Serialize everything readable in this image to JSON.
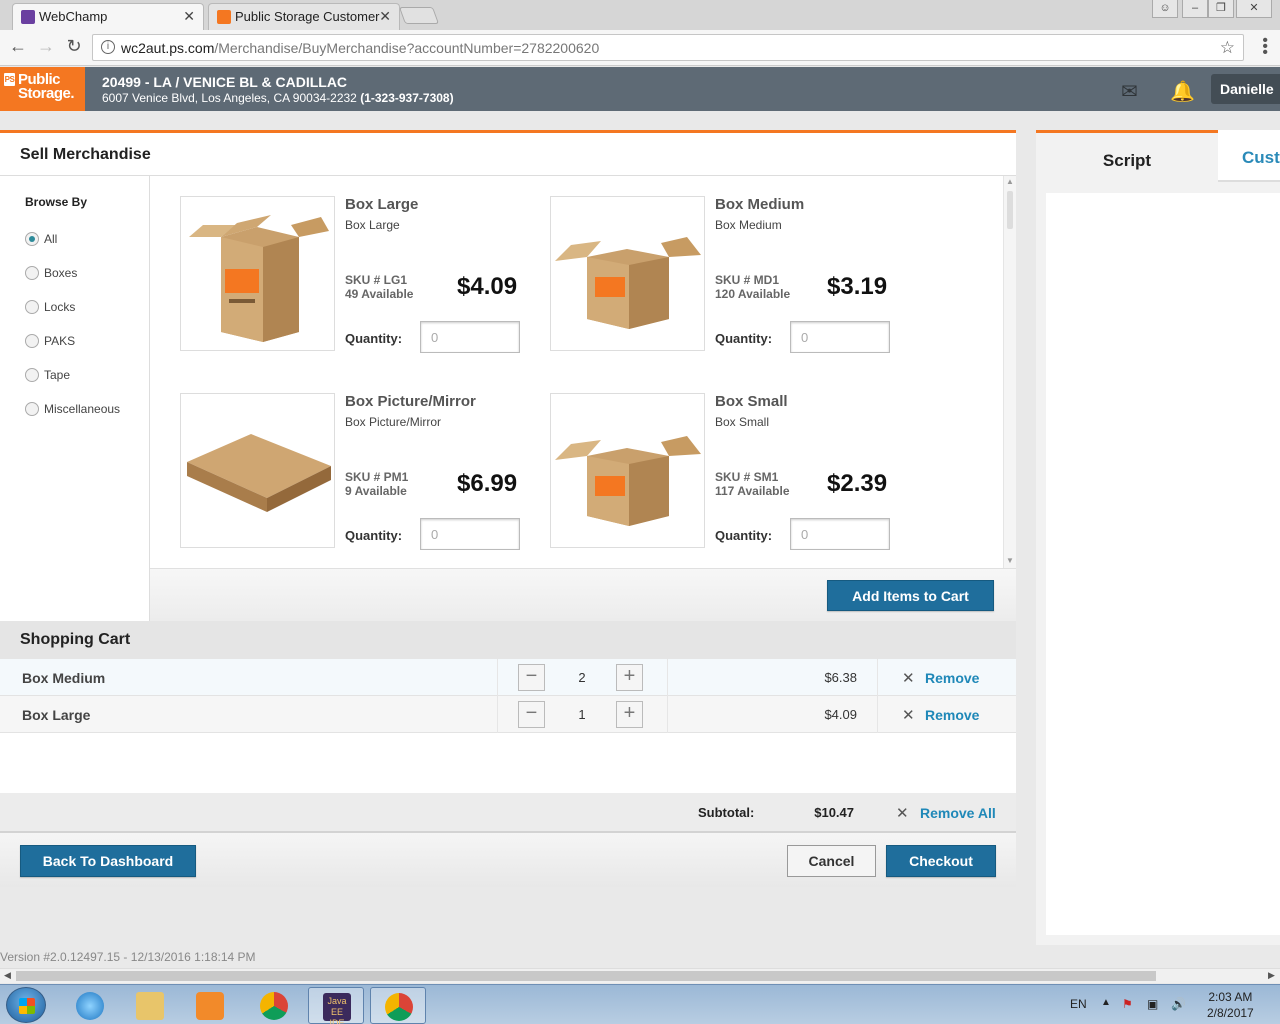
{
  "browser": {
    "tabs": [
      {
        "label": "WebChamp",
        "close": "✕",
        "favicon_color": "#6a3fa0"
      },
      {
        "label": "Public Storage Customer",
        "close": "✕",
        "favicon_color": "#f47721"
      }
    ],
    "url_host": "wc2aut.ps.com",
    "url_path": "/Merchandise/BuyMerchandise?accountNumber=2782200620"
  },
  "header": {
    "logo_line1": "Public",
    "logo_line2": "Storage.",
    "logo_mark": "PS",
    "site_title": "20499 - LA / VENICE BL & CADILLAC",
    "site_address": "6007 Venice Blvd, Los Angeles, CA 90034-2232",
    "site_phone": "(1-323-937-7308)",
    "user": "Danielle",
    "icons": [
      "mail-icon",
      "bell-icon"
    ]
  },
  "merchandise": {
    "title": "Sell Merchandise",
    "browse_title": "Browse By",
    "filters": [
      {
        "label": "All",
        "checked": true
      },
      {
        "label": "Boxes",
        "checked": false
      },
      {
        "label": "Locks",
        "checked": false
      },
      {
        "label": "PAKS",
        "checked": false
      },
      {
        "label": "Tape",
        "checked": false
      },
      {
        "label": "Miscellaneous",
        "checked": false
      }
    ],
    "qty_label": "Quantity:",
    "products": [
      {
        "name": "Box Large",
        "desc": "Box Large",
        "sku": "SKU # LG1",
        "available": "49 Available",
        "price": "$4.09",
        "qty_placeholder": "0"
      },
      {
        "name": "Box Medium",
        "desc": "Box Medium",
        "sku": "SKU # MD1",
        "available": "120 Available",
        "price": "$3.19",
        "qty_placeholder": "0"
      },
      {
        "name": "Box Picture/Mirror",
        "desc": "Box Picture/Mirror",
        "sku": "SKU # PM1",
        "available": "9 Available",
        "price": "$6.99",
        "qty_placeholder": "0"
      },
      {
        "name": "Box Small",
        "desc": "Box Small",
        "sku": "SKU # SM1",
        "available": "117 Available",
        "price": "$2.39",
        "qty_placeholder": "0"
      }
    ],
    "add_button": "Add Items to Cart"
  },
  "cart": {
    "title": "Shopping Cart",
    "items": [
      {
        "name": "Box Medium",
        "qty": "2",
        "amount": "$6.38",
        "remove": "Remove"
      },
      {
        "name": "Box Large",
        "qty": "1",
        "amount": "$4.09",
        "remove": "Remove"
      }
    ],
    "subtotal_label": "Subtotal:",
    "subtotal": "$10.47",
    "remove_all": "Remove All"
  },
  "footer": {
    "back": "Back To Dashboard",
    "cancel": "Cancel",
    "checkout": "Checkout",
    "version": "Version #2.0.12497.15 - 12/13/2016 1:18:14 PM"
  },
  "rightpanel": {
    "tab_script": "Script",
    "tab_customer": "Custo"
  },
  "taskbar": {
    "lang": "EN",
    "time": "2:03 AM",
    "date": "2/8/2017",
    "java_label": "Java EE IDE"
  }
}
